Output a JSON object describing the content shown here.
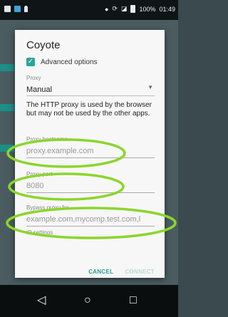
{
  "status_bar": {
    "battery_label": "100%",
    "time": "01:49",
    "icons": [
      "notification-icon",
      "image-icon",
      "location-pin-icon",
      "location-icon",
      "sync-icon",
      "signal-off-icon",
      "battery-icon"
    ]
  },
  "dialog": {
    "title": "Coyote",
    "advanced_options_label": "Advanced options",
    "advanced_options_checked": true,
    "proxy_label": "Proxy",
    "proxy_value": "Manual",
    "info_text": "The HTTP proxy is used by the browser but may not be used by the other apps.",
    "hostname_label": "Proxy hostname",
    "hostname_value": "proxy.example.com",
    "port_label": "Proxy port",
    "port_value": "8080",
    "bypass_label": "Bypass proxy for",
    "bypass_value": "example.com,mycomp.test.com,l",
    "ip_settings_label": "IP settings",
    "cancel_label": "CANCEL",
    "connect_label": "CONNECT"
  },
  "nav": {
    "back_glyph": "◁",
    "home_glyph": "○",
    "recents_glyph": "□"
  },
  "colors": {
    "accent": "#29a598",
    "annotation_green": "#8bd62b",
    "dialog_bg": "#f7f7f7",
    "status_bar_bg": "#0f1416"
  }
}
